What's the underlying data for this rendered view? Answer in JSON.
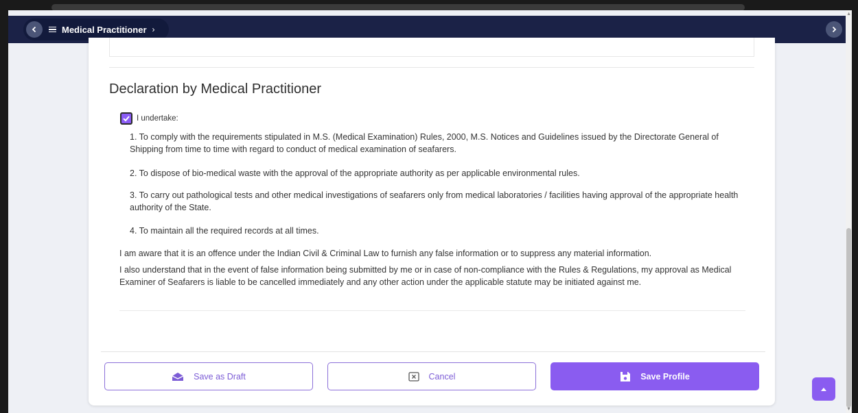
{
  "topbar": {
    "prev_icon": "chevron-left-icon",
    "menu_icon": "list-icon",
    "breadcrumb_title": "Medical Practitioner",
    "breadcrumb_chevron": "›",
    "next_icon": "chevron-right-icon"
  },
  "declaration": {
    "title": "Declaration by Medical Practitioner",
    "undertake_checked": true,
    "undertake_label": "I undertake:",
    "items": [
      "1. To comply with the requirements stipulated in M.S. (Medical Examination) Rules, 2000, M.S. Notices and Guidelines issued by the Directorate General of Shipping from time to time with regard to conduct of medical examination of seafarers.",
      "2. To dispose of bio-medical waste with the approval of the appropriate authority as per applicable environmental rules.",
      "3. To carry out pathological tests and other medical investigations of seafarers only from medical laboratories / facilities having approval of the appropriate health authority of the State.",
      "4. To maintain all the required records at all times."
    ],
    "aware_text": "I am aware that it is an offence under the Indian Civil & Criminal Law to furnish any false information or to suppress any material information.",
    "understand_text": "I also understand that in the event of false information being submitted by me or in case of non-compliance with the Rules & Regulations, my approval as Medical Examiner of Seafarers is liable to be cancelled immediately and any other action under the applicable statute may be initiated against me."
  },
  "actions": {
    "draft_label": "Save as Draft",
    "cancel_label": "Cancel",
    "save_label": "Save Profile"
  },
  "colors": {
    "accent": "#8a5cf0",
    "navbar": "#1b2247"
  }
}
